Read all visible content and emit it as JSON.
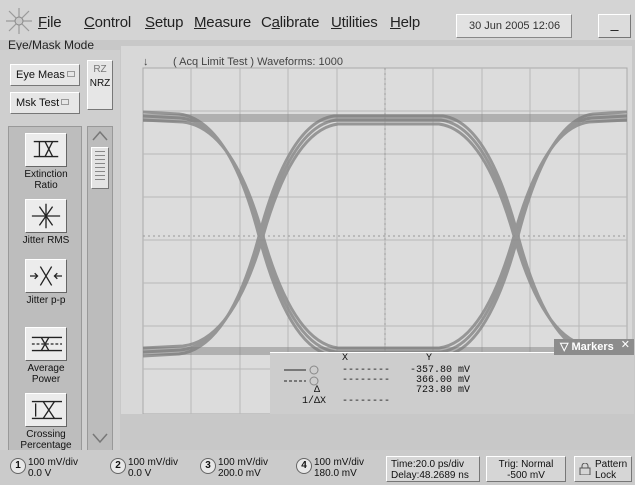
{
  "menubar": {
    "items": [
      "File",
      "Control",
      "Setup",
      "Measure",
      "Calibrate",
      "Utilities",
      "Help"
    ],
    "mnemonics": [
      "F",
      "C",
      "S",
      "M",
      "a",
      "U",
      "H"
    ],
    "date_time": "30 Jun 2005  12:06",
    "minimize_label": "_"
  },
  "panel": {
    "title": "Eye/Mask Mode",
    "eye_meas_label": "Eye Meas",
    "mask_test_label": "Msk Test",
    "rz_label": "RZ",
    "nrz_label": "NRZ",
    "measurements": [
      {
        "label": "Extinction Ratio",
        "icon": "extinction-ratio-icon"
      },
      {
        "label": "Jitter RMS",
        "icon": "jitter-rms-icon"
      },
      {
        "label": "Jitter p-p",
        "icon": "jitter-pp-icon"
      },
      {
        "label": "Average Power",
        "icon": "average-power-icon"
      },
      {
        "label": "Crossing Percentage",
        "icon": "crossing-percentage-icon"
      }
    ]
  },
  "screen": {
    "acq_label": "( Acq Limit Test )  Waveforms: 1000",
    "trace_color": "#8a8a8a"
  },
  "markers": {
    "title": "Markers",
    "x_header": "X",
    "y_header": "Y",
    "rows": [
      {
        "label": "",
        "x": "--------",
        "y": "-357.80 mV"
      },
      {
        "label": "",
        "x": "--------",
        "y": "366.00 mV"
      },
      {
        "label": "Δ",
        "x": "",
        "y": "723.80 mV"
      },
      {
        "label": "1/ΔX",
        "x": "--------",
        "y": ""
      }
    ]
  },
  "status": {
    "channels": [
      {
        "num": "1",
        "scale": "100 mV/div",
        "offset": "0.0 V"
      },
      {
        "num": "2",
        "scale": "100 mV/div",
        "offset": "0.0 V"
      },
      {
        "num": "3",
        "scale": "100 mV/div",
        "offset": "200.0 mV"
      },
      {
        "num": "4",
        "scale": "100 mV/div",
        "offset": "180.0 mV"
      }
    ],
    "time": "Time:20.0 ps/div",
    "delay": "Delay:48.2689 ns",
    "trig": "Trig: Normal",
    "trig_level": "-500 mV",
    "pattern_lock": "Pattern",
    "pattern_lock_2": "Lock"
  }
}
